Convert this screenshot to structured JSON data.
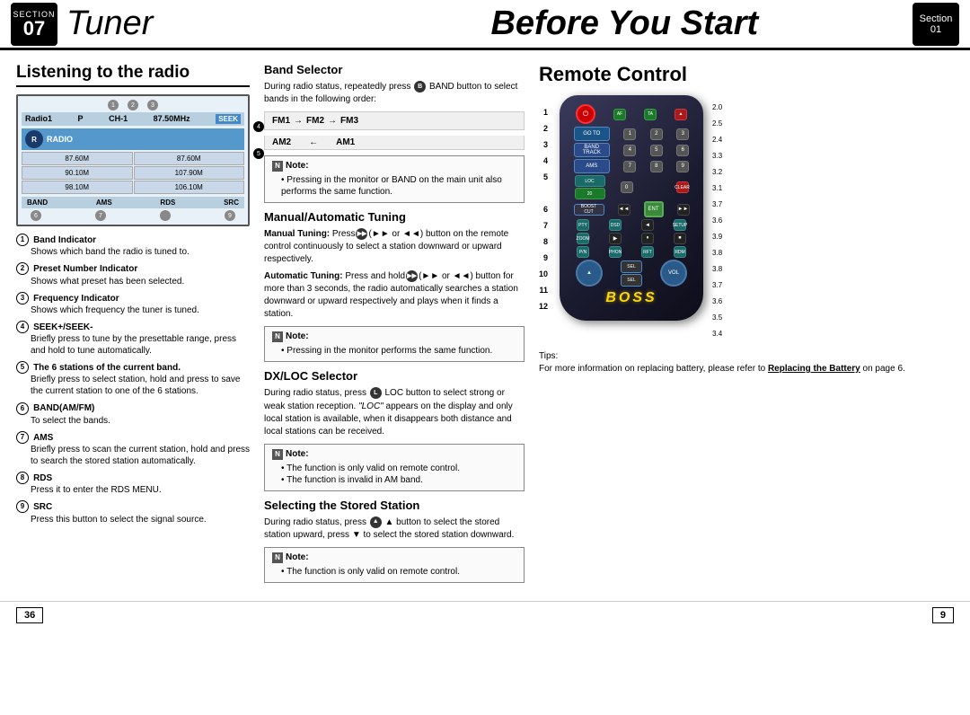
{
  "header": {
    "section_left_label": "Section",
    "section_left_num": "07",
    "title_left": "Tuner",
    "title_right": "Before You Start",
    "section_right_label": "Section",
    "section_right_num": "01"
  },
  "left": {
    "heading": "Listening to the radio",
    "radio_display": {
      "top_bar": "Radio1  P  CH-1  87.50MHz",
      "circles": [
        "1",
        "2",
        "3"
      ],
      "grid_cells": [
        "87.60M",
        "87.60M",
        "90.10M",
        "107.90M",
        "98.10M",
        "106.10M"
      ],
      "bottom_bar": [
        "BAND",
        "AMS",
        "RDS",
        "SRC"
      ],
      "side_label": "4",
      "side_label2": "5"
    },
    "items": [
      {
        "num": "1",
        "title": "Band Indicator",
        "desc": "Shows which band the radio is tuned to."
      },
      {
        "num": "2",
        "title": "Preset Number Indicator",
        "desc": "Shows what preset has been selected."
      },
      {
        "num": "3",
        "title": "Frequency Indicator",
        "desc": "Shows which frequency the tuner is tuned."
      },
      {
        "num": "4",
        "title": "SEEK+/SEEK-",
        "desc": "Briefly press to tune by the presettable range, press and hold to tune automatically."
      },
      {
        "num": "5",
        "title": "The 6 stations of the current band.",
        "desc": "Briefly press to select station, hold and press to save the current station to one of the 6 stations."
      },
      {
        "num": "6",
        "title": "BAND(AM/FM)",
        "desc": "To select the bands."
      },
      {
        "num": "7",
        "title": "AMS",
        "desc": "Briefly press to scan the current station, hold and press to search the stored station automatically."
      },
      {
        "num": "8",
        "title": "RDS",
        "desc": "Press it to enter the RDS MENU."
      },
      {
        "num": "9",
        "title": "SRC",
        "desc": "Press this button to select the signal source."
      }
    ]
  },
  "middle": {
    "subsections": [
      {
        "title": "Band Selector",
        "body": "During radio status, repeatedly press BAND button to select bands in the following order:",
        "flow": {
          "forward": [
            "FM1",
            "FM2",
            "FM3"
          ],
          "backward": [
            "AM2",
            "AM1"
          ]
        },
        "note": {
          "bullets": [
            "Pressing in the monitor or BAND on the main unit also performs the same function."
          ]
        }
      },
      {
        "title": "Manual/Automatic Tuning",
        "body_manual": "Manual Tuning: Press (►► or ◄◄) button on the remote control continuously to select a station downward or upward respectively.",
        "body_auto": "Automatic Tuning: Press and hold (►► or ◄◄) button for more than 3 seconds, the radio automatically searches a station downward or upward respectively and plays when it finds a station.",
        "note": {
          "bullets": [
            "Pressing in the monitor performs the same function."
          ]
        }
      },
      {
        "title": "DX/LOC Selector",
        "body": "During radio status, press LOC button to select strong or weak station reception. \"LOC\" appears on the display and only local station is available, when it disappears both distance and local stations can be received.",
        "note": {
          "bullets": [
            "The function is only valid on remote control.",
            "The function is invalid in AM band."
          ]
        }
      },
      {
        "title": "Selecting the Stored Station",
        "body": "During radio status, press ▲ button to select the stored station upward, press ▼ to select the stored station downward.",
        "note": {
          "bullets": [
            "The function is only valid on remote control."
          ]
        }
      }
    ]
  },
  "right": {
    "heading": "Remote Control",
    "remote": {
      "labels_left": [
        "1",
        "2",
        "3",
        "4",
        "5",
        "",
        "6",
        "7",
        "8",
        "9",
        "10",
        "11",
        "12"
      ],
      "labels_right": [
        "2.0",
        "2.5",
        "2.4",
        "3.3",
        "3.2",
        "3.1",
        "3.7",
        "3.6",
        "3.9",
        "3.8",
        "3.8",
        "3.7",
        "3.6",
        "3.5",
        "3.4"
      ]
    },
    "tips": {
      "label": "Tips:",
      "body": "For more information on replacing battery, please refer to",
      "link": "Replacing the Battery",
      "suffix": "on page 6."
    }
  },
  "footer": {
    "page_left": "36",
    "page_right": "9"
  }
}
